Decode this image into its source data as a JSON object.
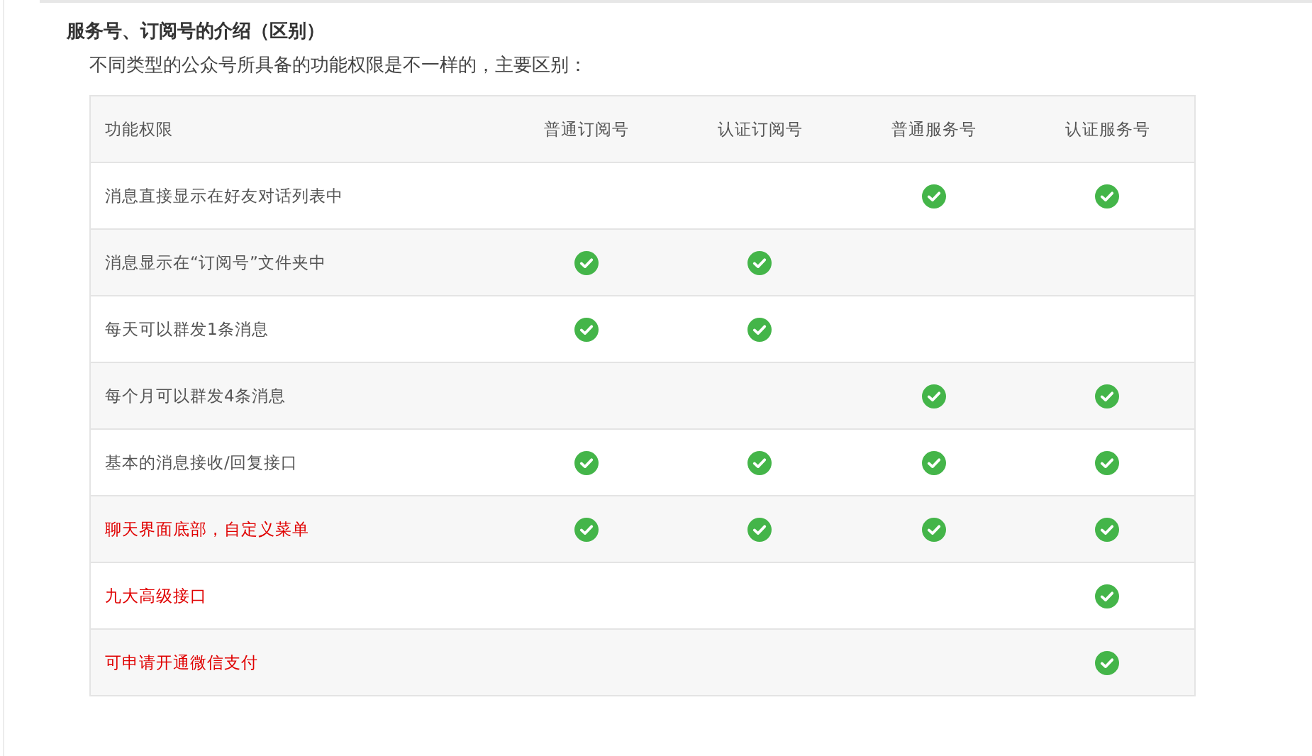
{
  "title": "服务号、订阅号的介绍（区别）",
  "intro": "不同类型的公众号所具备的功能权限是不一样的，主要区别：",
  "table": {
    "columns": [
      "功能权限",
      "普通订阅号",
      "认证订阅号",
      "普通服务号",
      "认证服务号"
    ],
    "rows": [
      {
        "feature": "消息直接显示在好友对话列表中",
        "highlight": false,
        "checks": [
          false,
          false,
          true,
          true
        ]
      },
      {
        "feature": "消息显示在“订阅号”文件夹中",
        "highlight": false,
        "checks": [
          true,
          true,
          false,
          false
        ]
      },
      {
        "feature": "每天可以群发1条消息",
        "highlight": false,
        "checks": [
          true,
          true,
          false,
          false
        ]
      },
      {
        "feature": "每个月可以群发4条消息",
        "highlight": false,
        "checks": [
          false,
          false,
          true,
          true
        ]
      },
      {
        "feature": "基本的消息接收/回复接口",
        "highlight": false,
        "checks": [
          true,
          true,
          true,
          true
        ]
      },
      {
        "feature": "聊天界面底部，自定义菜单",
        "highlight": true,
        "checks": [
          true,
          true,
          true,
          true
        ]
      },
      {
        "feature": "九大高级接口",
        "highlight": true,
        "checks": [
          false,
          false,
          false,
          true
        ]
      },
      {
        "feature": "可申请开通微信支付",
        "highlight": true,
        "checks": [
          false,
          false,
          false,
          true
        ]
      }
    ]
  }
}
